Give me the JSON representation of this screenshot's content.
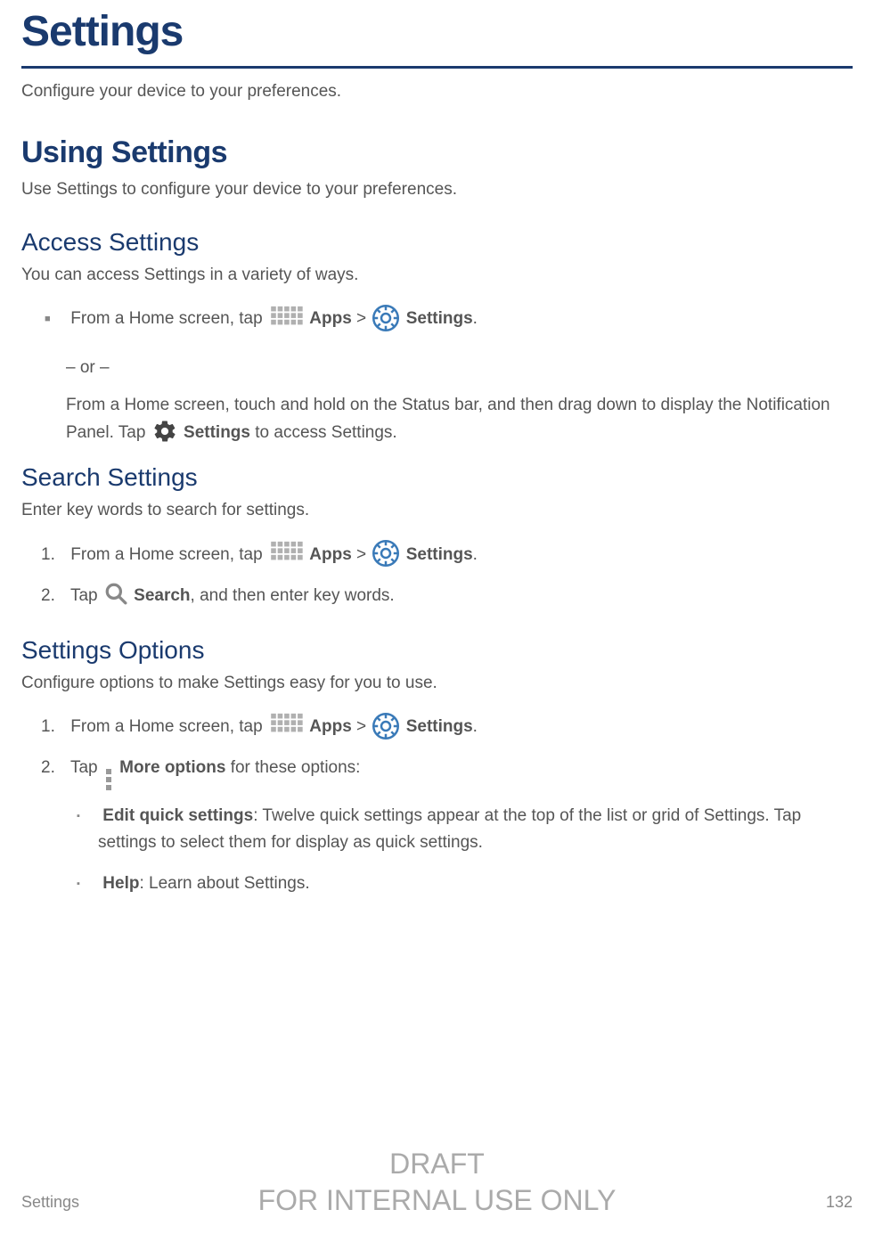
{
  "chapter": {
    "title": "Settings",
    "intro": "Configure your device to your preferences."
  },
  "section_using": {
    "title": "Using Settings",
    "intro": "Use Settings to configure your device to your preferences."
  },
  "sub_access": {
    "title": "Access Settings",
    "intro": "You can access Settings in a variety of ways.",
    "step1_pre": "From a Home screen, tap ",
    "apps_label": "Apps",
    "gt": " > ",
    "settings_label": "Settings",
    "period": ".",
    "or": "– or –",
    "alt_pre": "From a Home screen, touch and hold on the Status bar, and then drag down to display the Notification Panel. Tap ",
    "alt_settings_label": "Settings",
    "alt_post": " to access Settings."
  },
  "sub_search": {
    "title": "Search Settings",
    "intro": "Enter key words to search for settings.",
    "step1_pre": "From a Home screen, tap ",
    "apps_label": "Apps",
    "gt": " > ",
    "settings_label": "Settings",
    "period": ".",
    "step2_pre": "Tap ",
    "search_label": "Search",
    "step2_post": ", and then enter key words."
  },
  "sub_options": {
    "title": "Settings Options",
    "intro": "Configure options to make Settings easy for you to use.",
    "step1_pre": "From a Home screen, tap ",
    "apps_label": "Apps",
    "gt": " > ",
    "settings_label": "Settings",
    "period": ".",
    "step2_pre": "Tap ",
    "more_label": "More options",
    "step2_post": " for these options:",
    "bullet1_bold": "Edit quick settings",
    "bullet1_rest": ": Twelve quick settings appear at the top of the list or grid of Settings. Tap settings to select them for display as quick settings.",
    "bullet2_bold": "Help",
    "bullet2_rest": ": Learn about Settings."
  },
  "footer": {
    "section_name": "Settings",
    "page_number": "132"
  },
  "watermark": {
    "line1": "DRAFT",
    "line2": "FOR INTERNAL USE ONLY"
  }
}
